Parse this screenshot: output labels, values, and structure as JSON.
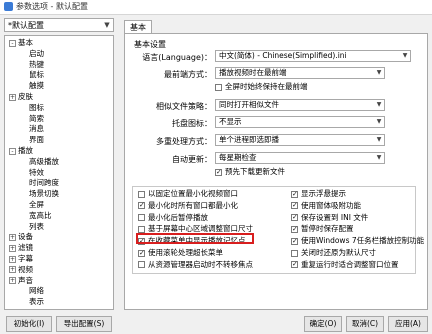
{
  "window": {
    "title": "参数选项 - 默认配置"
  },
  "profile": {
    "value": "*默认配置"
  },
  "tree": [
    {
      "label": "基本",
      "expander": "-"
    },
    {
      "label": "启动",
      "expander": ""
    },
    {
      "label": "热键",
      "expander": ""
    },
    {
      "label": "鼠标",
      "expander": ""
    },
    {
      "label": "触摸",
      "expander": ""
    },
    {
      "label": "皮肤",
      "expander": "+"
    },
    {
      "label": "图标",
      "expander": ""
    },
    {
      "label": "简索",
      "expander": ""
    },
    {
      "label": "消息",
      "expander": ""
    },
    {
      "label": "界面",
      "expander": ""
    },
    {
      "label": "播放",
      "expander": "-"
    },
    {
      "label": "高级播放",
      "expander": ""
    },
    {
      "label": "特效",
      "expander": ""
    },
    {
      "label": "时间跨度",
      "expander": ""
    },
    {
      "label": "场景切换",
      "expander": ""
    },
    {
      "label": "全屏",
      "expander": ""
    },
    {
      "label": "宽高比",
      "expander": ""
    },
    {
      "label": "列表",
      "expander": ""
    },
    {
      "label": "设备",
      "expander": "+"
    },
    {
      "label": "滤镜",
      "expander": "+"
    },
    {
      "label": "字幕",
      "expander": "+"
    },
    {
      "label": "视频",
      "expander": "+"
    },
    {
      "label": "声音",
      "expander": "+"
    },
    {
      "label": "网络",
      "expander": ""
    },
    {
      "label": "表示",
      "expander": ""
    }
  ],
  "tab": {
    "label": "基本"
  },
  "group": {
    "title": "基本设置"
  },
  "settings": {
    "language": {
      "label": "语言(Language)：",
      "value": "中文(简体) - Chinese(Simplified).ini"
    },
    "topmost": {
      "label": "最前端方式：",
      "value": "播放视频时在最前端"
    },
    "topmost_check": "全屏时始终保持在最前端",
    "similar": {
      "label": "相似文件策略：",
      "value": "同时打开相似文件"
    },
    "tray": {
      "label": "托盘图标：",
      "value": "不显示"
    },
    "multi": {
      "label": "多重处理方式：",
      "value": "单个进程即选即播"
    },
    "update": {
      "label": "自动更新：",
      "value": "每星期检查"
    },
    "predownload": "预先下载更新文件"
  },
  "options_left": [
    {
      "label": "以固定位置最小化视频窗口",
      "checked": false
    },
    {
      "label": "最小化时所有窗口都最小化",
      "checked": true
    },
    {
      "label": "最小化后暂停播放",
      "checked": false
    },
    {
      "label": "基于屏幕中心区域调整窗口尺寸",
      "checked": false
    },
    {
      "label": "在收藏菜单中显示播放记忆点",
      "checked": true
    },
    {
      "label": "使用滚轮处理超长菜单",
      "checked": true
    },
    {
      "label": "从资源管理器启动时不转移焦点",
      "checked": false
    }
  ],
  "options_right": [
    {
      "label": "显示浮悬提示",
      "checked": true
    },
    {
      "label": "使用窗体吸附功能",
      "checked": true
    },
    {
      "label": "保存设置到 INI 文件",
      "checked": true
    },
    {
      "label": "暂停时保存配置",
      "checked": true
    },
    {
      "label": "使用Windows 7任务栏播放控制功能",
      "checked": true
    },
    {
      "label": "关闭时还原为默认尺寸",
      "checked": false
    },
    {
      "label": "重复运行时适合调整窗口位置",
      "checked": true
    }
  ],
  "buttons": {
    "init": "初始化(I)",
    "export": "导出配置(S)",
    "ok": "确定(O)",
    "cancel": "取消(C)",
    "apply": "应用(A)"
  }
}
